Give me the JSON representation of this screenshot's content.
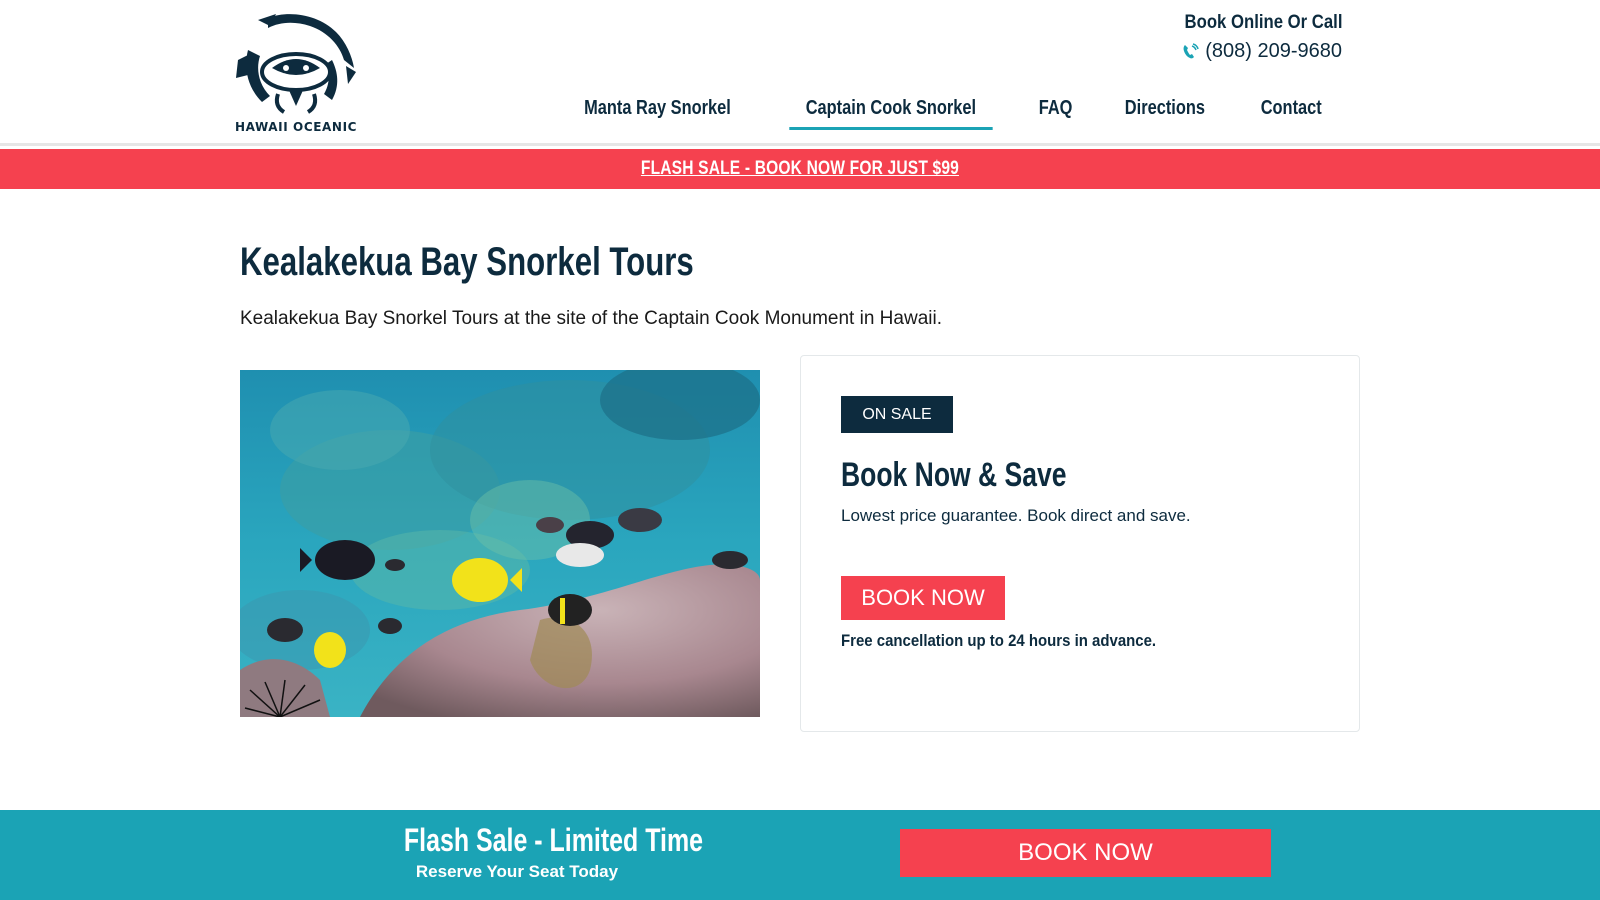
{
  "header": {
    "logo_text": "HAWAII OCEANIC",
    "contact_label": "Book Online Or Call",
    "phone": "(808) 209-9680",
    "phone_icon": "phone-icon"
  },
  "nav": {
    "items": [
      {
        "label": "Manta Ray Snorkel",
        "active": false
      },
      {
        "label": "Captain Cook Snorkel",
        "active": true
      },
      {
        "label": "FAQ",
        "active": false
      },
      {
        "label": "Directions",
        "active": false
      },
      {
        "label": "Contact",
        "active": false
      }
    ]
  },
  "flash_bar": {
    "text": "FLASH SALE - BOOK NOW FOR JUST $99"
  },
  "main": {
    "title": "Kealakekua Bay Snorkel Tours",
    "subtitle": "Kealakekua Bay Snorkel Tours at the site of the Captain Cook Monument in Hawaii."
  },
  "card": {
    "badge": "ON SALE",
    "title": "Book Now & Save",
    "text": "Lowest price guarantee. Book direct and save.",
    "button": "BOOK NOW",
    "note": "Free cancellation up to 24 hours in advance."
  },
  "bottom_bar": {
    "title": "Flash Sale - Limited Time",
    "subtitle": "Reserve Your Seat Today",
    "button": "BOOK NOW"
  },
  "colors": {
    "navy": "#0d2b3e",
    "coral": "#f5414f",
    "teal": "#1ba3b5"
  }
}
